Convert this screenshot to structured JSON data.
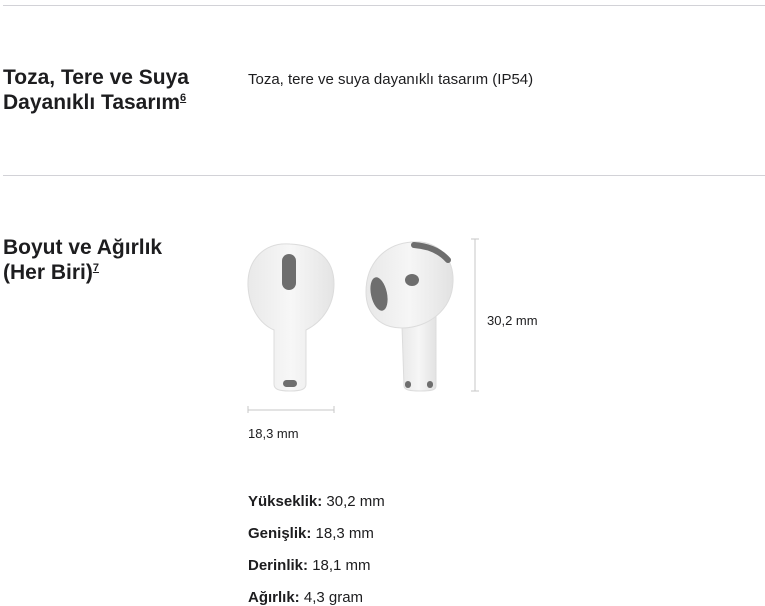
{
  "section_water": {
    "title_line1": "Toza, Tere ve Suya",
    "title_line2": "Dayanıklı Tasarım",
    "footnote": "6",
    "description": "Toza, tere ve suya dayanıklı tasarım (IP54)"
  },
  "section_size": {
    "title_line1": "Boyut ve Ağırlık",
    "title_line2": "(Her Biri)",
    "footnote": "7",
    "height_dim": "30,2 mm",
    "width_dim": "18,3 mm",
    "specs": [
      {
        "label": "Yükseklik:",
        "value": "30,2 mm"
      },
      {
        "label": "Genişlik:",
        "value": "18,3 mm"
      },
      {
        "label": "Derinlik:",
        "value": "18,1 mm"
      },
      {
        "label": "Ağırlık:",
        "value": "4,3 gram"
      }
    ]
  }
}
